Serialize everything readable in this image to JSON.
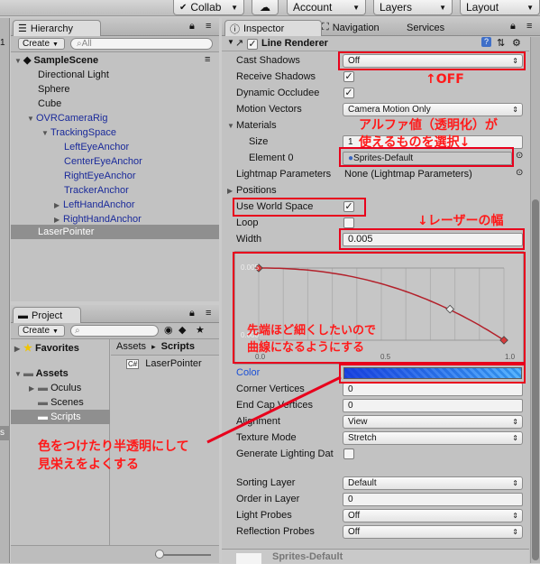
{
  "toolbar": {
    "collab_label": "Collab",
    "account_label": "Account",
    "layers_label": "Layers",
    "layout_label": "Layout"
  },
  "hierarchy": {
    "tab_label": "Hierarchy",
    "create_label": "Create",
    "search_placeholder": "All",
    "scene_name": "SampleScene",
    "items": [
      {
        "label": "Directional Light"
      },
      {
        "label": "Sphere"
      },
      {
        "label": "Cube"
      },
      {
        "label": "OVRCameraRig"
      },
      {
        "label": "TrackingSpace"
      },
      {
        "label": "LeftEyeAnchor"
      },
      {
        "label": "CenterEyeAnchor"
      },
      {
        "label": "RightEyeAnchor"
      },
      {
        "label": "TrackerAnchor"
      },
      {
        "label": "LeftHandAnchor"
      },
      {
        "label": "RightHandAnchor"
      },
      {
        "label": "LaserPointer"
      }
    ]
  },
  "project": {
    "tab_label": "Project",
    "create_label": "Create",
    "favorites_label": "Favorites",
    "assets_label": "Assets",
    "folders": [
      {
        "label": "Oculus"
      },
      {
        "label": "Scenes"
      },
      {
        "label": "Scripts"
      }
    ],
    "breadcrumb_assets": "Assets",
    "breadcrumb_sep": "▸",
    "breadcrumb_scripts": "Scripts",
    "file_name": "LaserPointer",
    "side_label": "s"
  },
  "inspector": {
    "tabs": [
      {
        "label": "Inspector"
      },
      {
        "label": "Navigation"
      },
      {
        "label": "Services"
      }
    ],
    "component_title": "Line Renderer",
    "cast_shadows_label": "Cast Shadows",
    "cast_shadows_value": "Off",
    "receive_shadows_label": "Receive Shadows",
    "dynamic_occludee_label": "Dynamic Occludee",
    "motion_vectors_label": "Motion Vectors",
    "motion_vectors_value": "Camera Motion Only",
    "materials_label": "Materials",
    "size_label": "Size",
    "size_value": "1",
    "element0_label": "Element 0",
    "element0_value": "Sprites-Default",
    "lightmap_label": "Lightmap Parameters",
    "lightmap_value": "None (Lightmap Parameters)",
    "positions_label": "Positions",
    "use_world_space_label": "Use World Space",
    "loop_label": "Loop",
    "width_label": "Width",
    "width_value": "0.005",
    "curve": {
      "y_top_label": "0.005",
      "y_bottom_label": "0.000",
      "x_labels": [
        "0.0",
        "0.5",
        "1.0"
      ],
      "points": [
        [
          0.0,
          0.005
        ],
        [
          0.78,
          0.00215
        ],
        [
          1.0,
          0.0
        ]
      ]
    },
    "color_label": "Color",
    "corner_vertices_label": "Corner Vertices",
    "corner_vertices_value": "0",
    "end_cap_label": "End Cap Vertices",
    "end_cap_value": "0",
    "alignment_label": "Alignment",
    "alignment_value": "View",
    "texture_mode_label": "Texture Mode",
    "texture_mode_value": "Stretch",
    "generate_lighting_label": "Generate Lighting Dat",
    "sorting_layer_label": "Sorting Layer",
    "sorting_layer_value": "Default",
    "order_in_layer_label": "Order in Layer",
    "order_in_layer_value": "0",
    "light_probes_label": "Light Probes",
    "light_probes_value": "Off",
    "reflection_probes_label": "Reflection Probes",
    "reflection_probes_value": "Off",
    "footer_material": "Sprites-Default"
  },
  "annotations": {
    "off": "↑OFF",
    "alpha_line1": "アルファ値（透明化）が",
    "alpha_line2": "使えるものを選択↓",
    "laser_width": "↓レーザーの幅",
    "curve_line1": "先端ほど細くしたいので",
    "curve_line2": "曲線になるようにする",
    "color_line1": "色をつけたり半透明にして",
    "color_line2": "見栄えをよくする"
  },
  "colors": {
    "annotation_red": "#e8001c",
    "selection_bg": "#8f8f8f",
    "prefab_blue": "#1a2a9a"
  }
}
